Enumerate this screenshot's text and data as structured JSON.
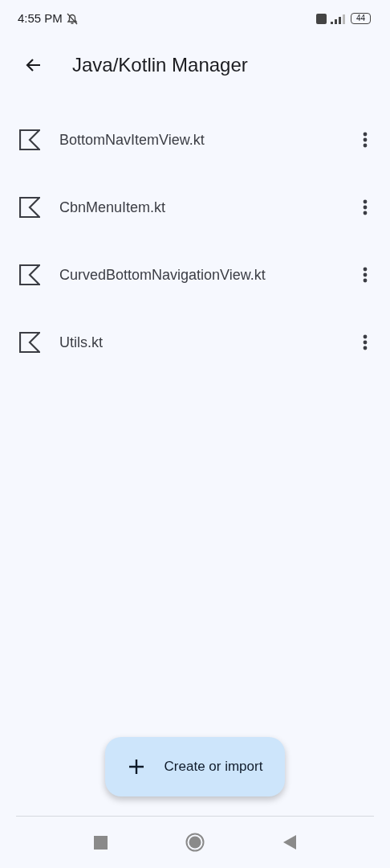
{
  "status_bar": {
    "time": "4:55 PM",
    "battery": "44"
  },
  "app_bar": {
    "title": "Java/Kotlin Manager"
  },
  "files": [
    {
      "name": "BottomNavItemView.kt"
    },
    {
      "name": "CbnMenuItem.kt"
    },
    {
      "name": "CurvedBottomNavigationView.kt"
    },
    {
      "name": "Utils.kt"
    }
  ],
  "fab": {
    "label": "Create or import"
  }
}
